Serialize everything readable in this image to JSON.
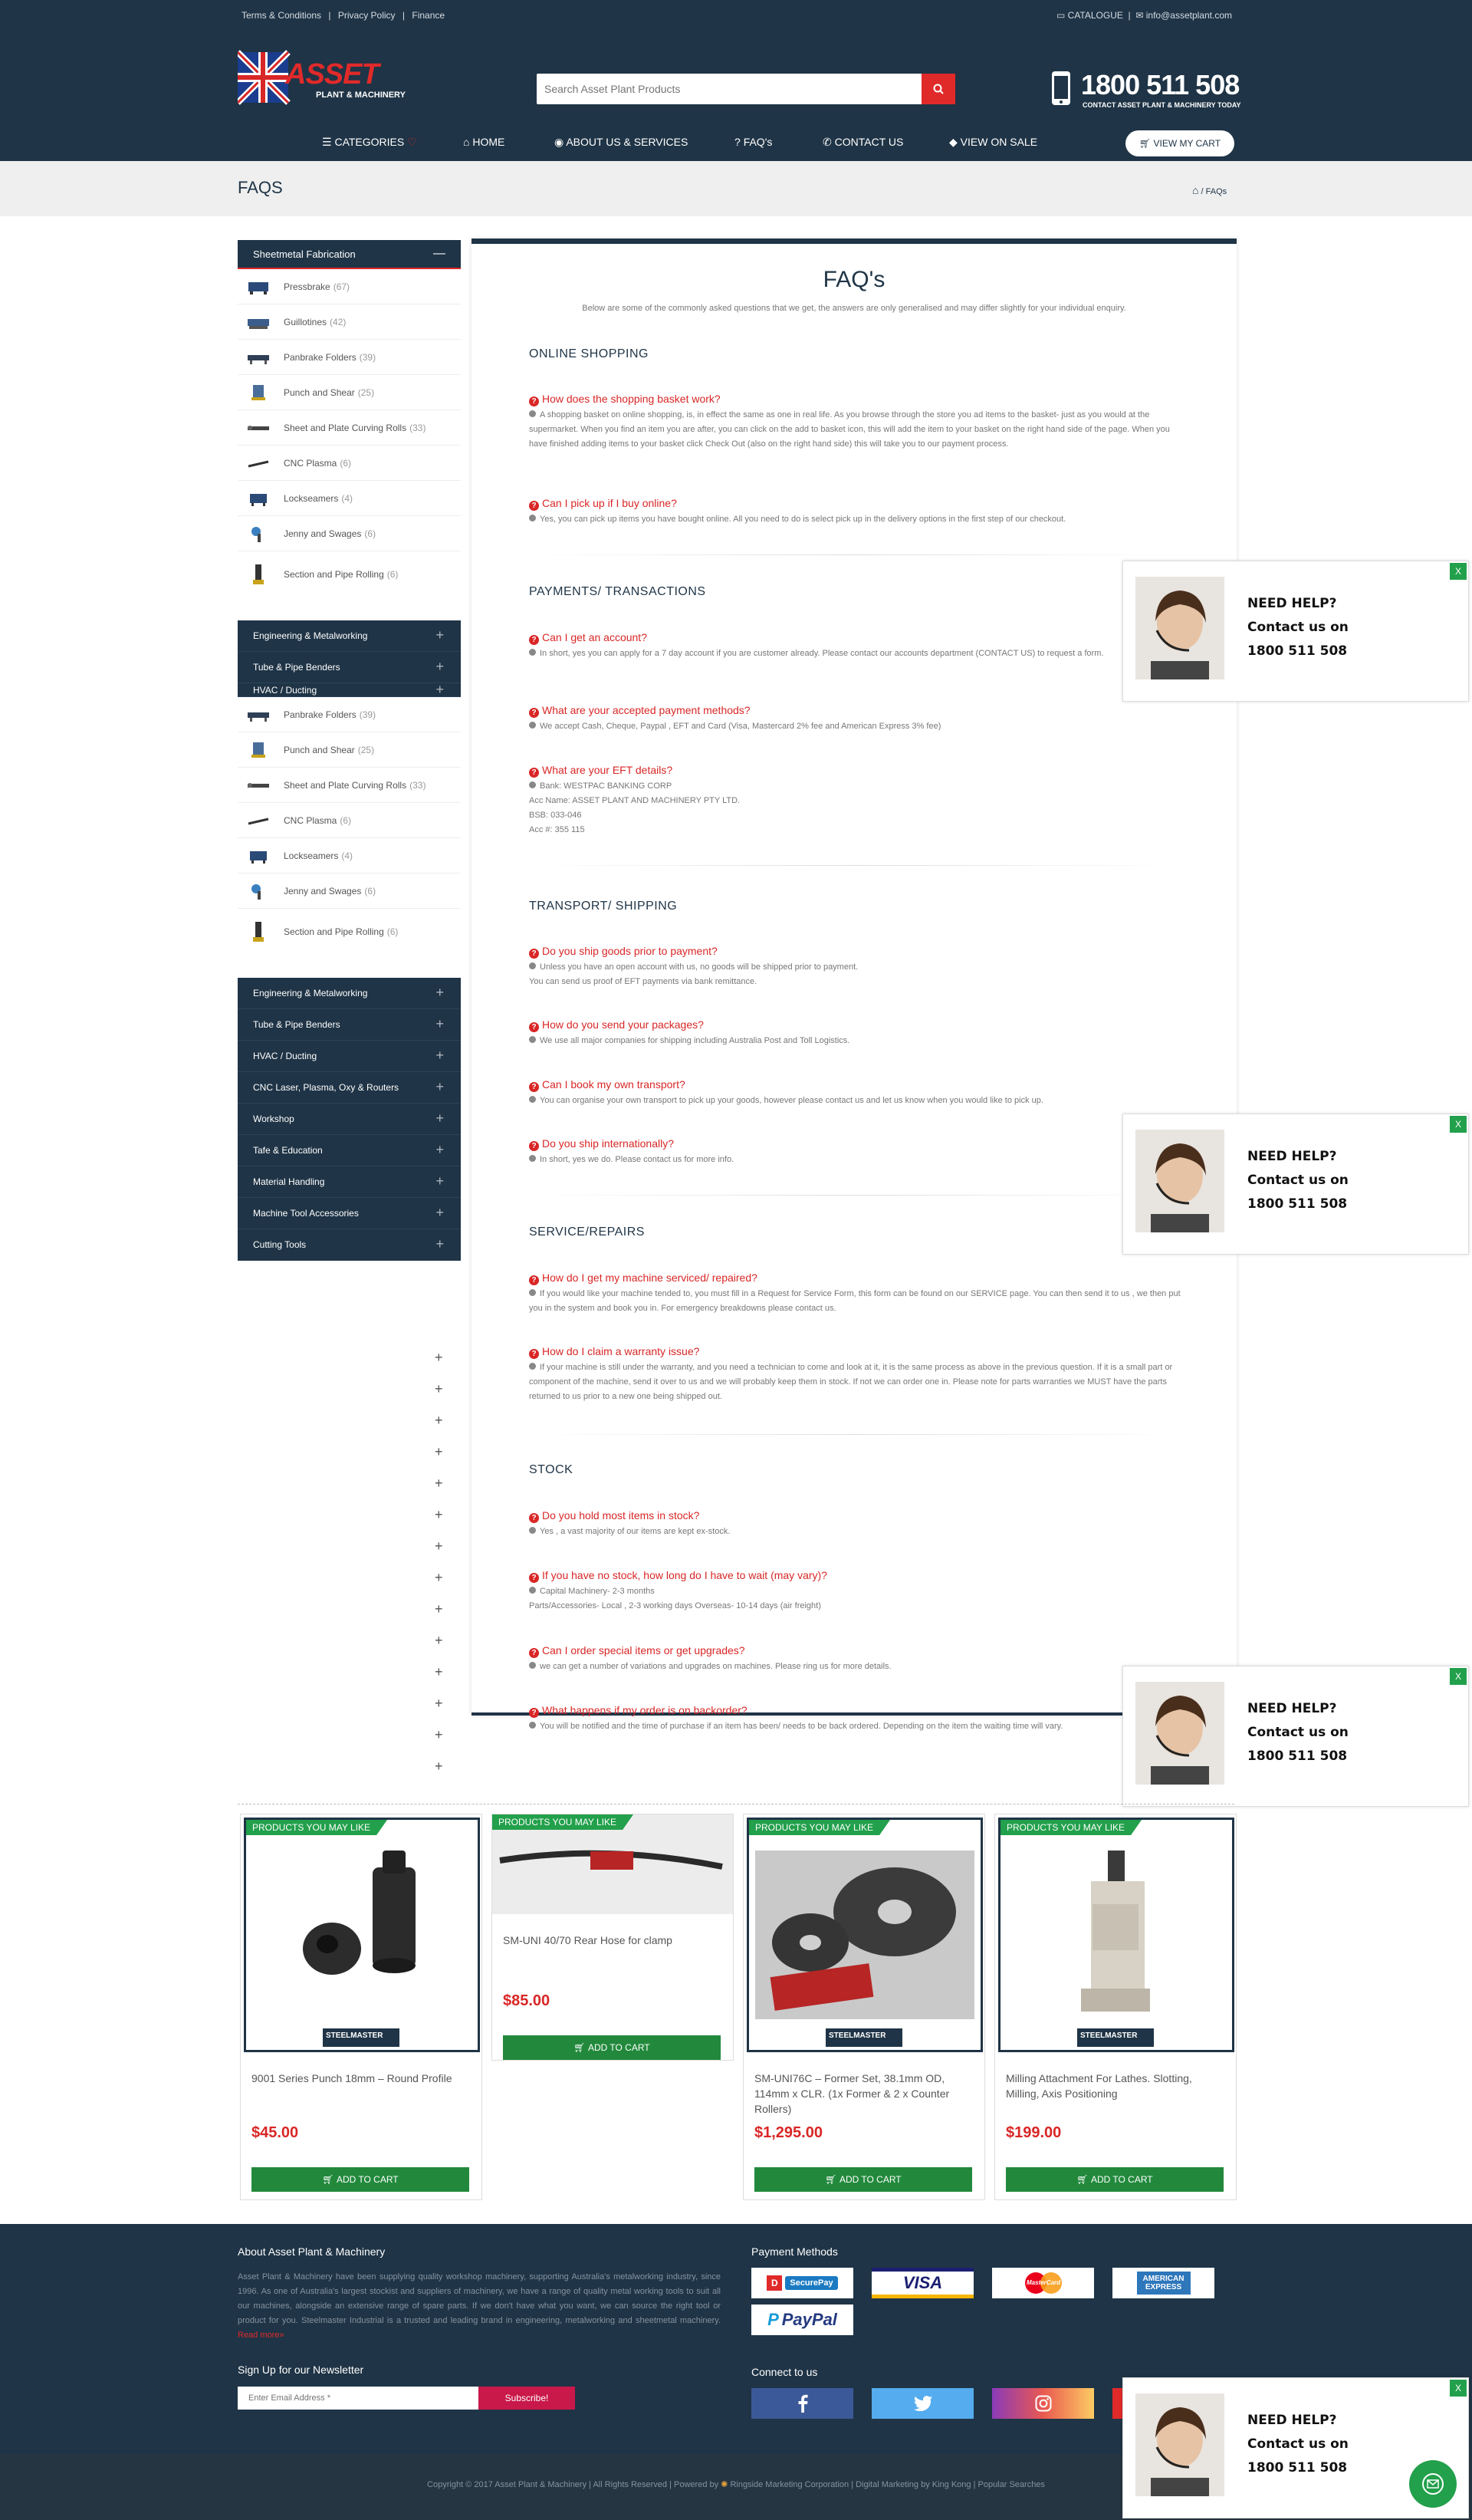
{
  "topbar": {
    "links": [
      "Terms & Conditions",
      "|",
      "Privacy Policy",
      "|",
      "Finance"
    ],
    "catalogue": "CATALOGUE",
    "email": "info@assetplant.com"
  },
  "logo": {
    "line1": "ASSET",
    "line2": "PLANT & MACHINERY"
  },
  "search": {
    "placeholder": "Search Asset Plant Products"
  },
  "phone": {
    "number": "1800 511 508",
    "sub": "CONTACT ASSET PLANT & MACHINERY TODAY"
  },
  "nav": {
    "items": [
      "CATEGORIES",
      "HOME",
      "ABOUT US & SERVICES",
      "FAQ's",
      "CONTACT US",
      "VIEW ON SALE"
    ],
    "cart": "VIEW MY CART"
  },
  "banner": {
    "title": "FAQS",
    "crumb": "FAQs"
  },
  "sidebar": {
    "open_category": "Sheetmetal Fabrication",
    "products": [
      {
        "name": "Pressbrake",
        "count": "(67)"
      },
      {
        "name": "Guillotines",
        "count": "(42)"
      },
      {
        "name": "Panbrake Folders",
        "count": "(39)"
      },
      {
        "name": "Punch and Shear",
        "count": "(25)"
      },
      {
        "name": "Sheet and Plate Curving Rolls",
        "count": "(33)"
      },
      {
        "name": "CNC Plasma",
        "count": "(6)"
      },
      {
        "name": "Lockseamers",
        "count": "(4)"
      },
      {
        "name": "Jenny and Swages",
        "count": "(6)"
      },
      {
        "name": "Section and Pipe Rolling",
        "count": "(6)"
      }
    ],
    "overlap_categories": [
      "Engineering & Metalworking",
      "Tube & Pipe Benders",
      "HVAC / Ducting"
    ],
    "categories": [
      "Engineering & Metalworking",
      "Tube & Pipe Benders",
      "HVAC / Ducting",
      "CNC Laser, Plasma, Oxy & Routers",
      "Workshop",
      "Tafe & Education",
      "Material Handling",
      "Machine Tool Accessories",
      "Cutting Tools"
    ]
  },
  "faq": {
    "title": "FAQ's",
    "intro": "Below are some of the commonly asked questions that we get, the answers are only generalised and may differ slightly for your individual enquiry.",
    "sections": {
      "s1": "ONLINE SHOPPING",
      "s2": "PAYMENTS/ TRANSACTIONS",
      "s3": "TRANSPORT/ SHIPPING",
      "s4": "SERVICE/REPAIRS",
      "s5": "STOCK"
    },
    "q": {
      "q1": "How does the shopping basket work?",
      "a1": "A shopping basket on online shopping, is, in effect the same as one in real life. As you browse through the store you ad items to the basket- just as you would at the supermarket.  When you find an item you are after, you can click on the add to basket icon, this will add the item to your basket on the right hand side of the page. When you have finished adding items to your basket click Check Out (also on the right hand side) this will take you to our payment process.",
      "q2": "Can I pick up if I buy online?",
      "a2": "Yes, you can pick up items you have bought online. All you need to do is select pick up in the delivery options in the first step of our checkout.",
      "q3": "Can I get an account?",
      "a3": "In short, yes you can apply for a 7 day account if you are customer already. Please contact our accounts department (CONTACT US) to request a form.",
      "q4": "What are your accepted payment methods?",
      "a4": "We accept Cash, Cheque, Paypal , EFT and Card (Visa, Mastercard 2% fee and American Express 3% fee)",
      "q5": "What are your EFT details?",
      "a5_1": "Bank: WESTPAC BANKING CORP",
      "a5_2": "Acc Name: ASSET PLANT AND MACHINERY PTY LTD.",
      "a5_3": "BSB: 033-046",
      "a5_4": "Acc #: 355 115",
      "q6": "Do you ship goods prior to payment?",
      "a6_1": "Unless you have an open account with us, no goods will be shipped prior to payment.",
      "a6_2": "You can send us proof of EFT payments via bank remittance.",
      "q7": "How do you send your packages?",
      "a7": "We use all major companies for shipping including Australia Post and Toll Logistics.",
      "q8": "Can I book my own transport?",
      "a8": "You can organise your own transport to pick up your goods, however please contact us and let us know when you would like to pick up.",
      "q9": "Do you ship internationally?",
      "a9": "In short, yes we do. Please contact us for more info.",
      "q10": "How do I get my machine serviced/ repaired?",
      "a10": "If you would like your machine tended to, you must fill in a Request for Service Form, this form can be found on our SERVICE page. You can then send it to us , we then put you in the system and book you in. For emergency breakdowns please contact us.",
      "q11": "How do I claim a warranty issue?",
      "a11": "If your machine is still under the warranty, and you need a technician to come and look at it, it is the same process as above in the previous question. If it is a small part or component of the machine, send it over to us and we will probably keep them in stock. If not we can order one in. Please note for parts warranties we MUST have the parts returned to us prior to a new one being shipped out.",
      "q12": "Do you hold most items in stock?",
      "a12": "Yes , a vast majority of our items are kept ex-stock.",
      "q13": "If you have no stock, how long do I have to wait (may vary)?",
      "a13_1": "Capital Machinery- 2-3 months",
      "a13_2": "Parts/Accessories- Local , 2-3 working days Overseas- 10-14 days (air freight)",
      "q14": "Can I order special items or get upgrades?",
      "a14": "we can get a number of variations and upgrades on machines. Please ring us for more details.",
      "q15": "What happens if my order is on backorder?",
      "a15": "You will be notified and the time of purchase if an item has been/ needs to be back ordered. Depending on the item the waiting time will vary."
    }
  },
  "help": {
    "l1": "NEED HELP?",
    "l2": "Contact us on",
    "l3": "1800 511 508",
    "close": "X"
  },
  "products": {
    "badge": "PRODUCTS YOU MAY LIKE",
    "add": "ADD TO CART",
    "brand": "STEELMASTER",
    "items": [
      {
        "name": "9001 Series Punch 18mm – Round Profile",
        "price": "$45.00"
      },
      {
        "name": "SM-UNI 40/70 Rear Hose for clamp",
        "price": "$85.00"
      },
      {
        "name": "SM-UNI76C – Former Set, 38.1mm OD, 114mm x CLR. (1x Former & 2 x Counter Rollers)",
        "price": "$1,295.00"
      },
      {
        "name": "Milling Attachment For Lathes. Slotting, Milling, Axis Positioning",
        "price": "$199.00"
      }
    ]
  },
  "footer": {
    "about_title": "About Asset Plant & Machinery",
    "about_text": "Asset Plant & Machinery have been supplying quality workshop machinery, supporting Australia's metalworking industry, since 1996. As one of Australia's largest stockist and suppliers of machinery, we have a range of quality metal working tools to suit all our machines, alongside an extensive range of spare parts. If we don't have what you want, we can source the right tool or product for you. Steelmaster Industrial is a trusted and leading brand in engineering, metalworking and sheetmetal machinery.",
    "read_more": "Read more»",
    "newsletter_title": "Sign Up for our Newsletter",
    "email_placeholder": "Enter Email Address *",
    "subscribe": "Subscribe!",
    "payment_title": "Payment Methods",
    "payments": [
      "SecurePay",
      "VISA",
      "MasterCard",
      "AMERICAN EXPRESS",
      "PayPal"
    ],
    "connect_title": "Connect to us",
    "copyright": "Copyright © 2017 Asset Plant & Machinery | All Rights Reserved | Powered by",
    "powered": "Ringside Marketing Corporation | Digital Marketing by King Kong | Popular Searches"
  },
  "colors": {
    "navy": "#1f3446",
    "red": "#d92626",
    "green": "#22a04b"
  }
}
